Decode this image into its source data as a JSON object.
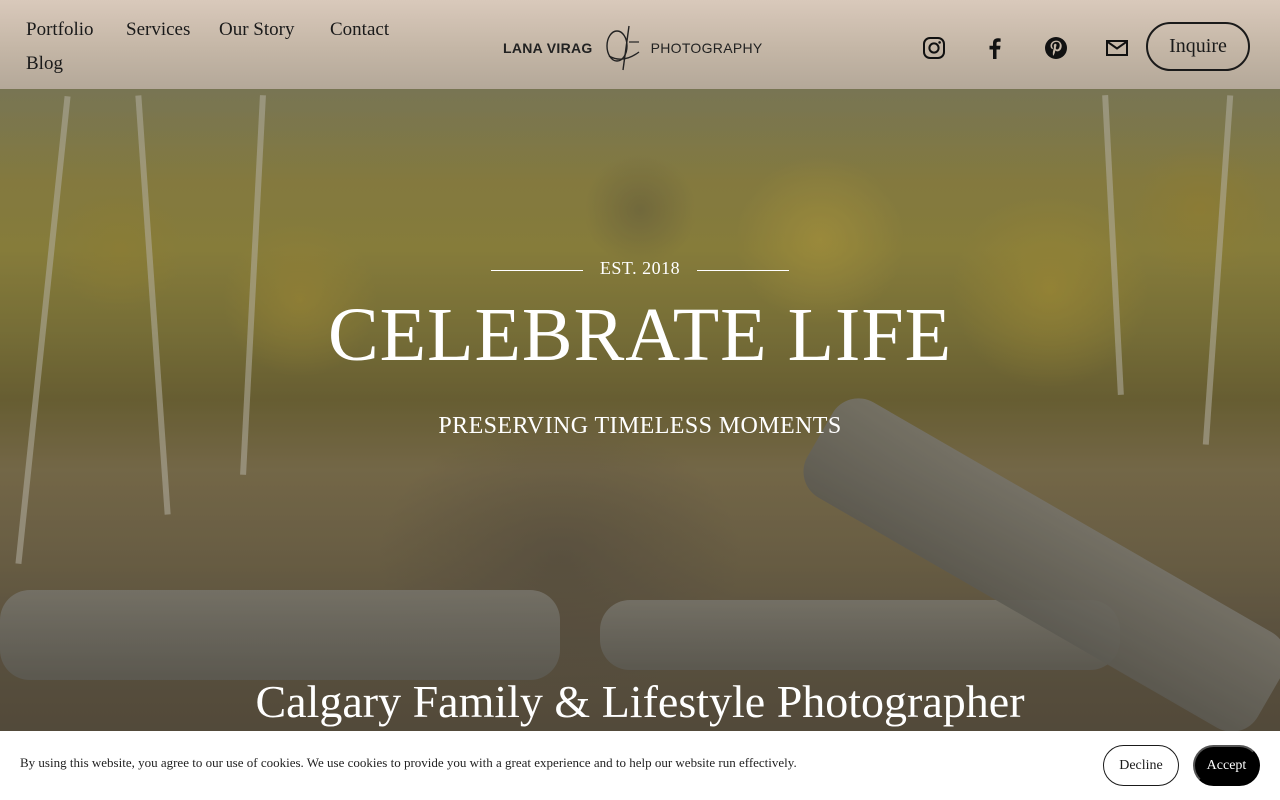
{
  "nav": {
    "items": [
      {
        "label": "Portfolio"
      },
      {
        "label": "Services"
      },
      {
        "label": "Our Story"
      },
      {
        "label": "Contact"
      },
      {
        "label": "Blog"
      }
    ]
  },
  "logo": {
    "left_text": "LANA VIRAG",
    "right_text": "PHOTOGRAPHY"
  },
  "social": [
    {
      "icon": "instagram-icon"
    },
    {
      "icon": "facebook-icon"
    },
    {
      "icon": "pinterest-icon"
    },
    {
      "icon": "email-icon"
    }
  ],
  "header": {
    "inquire_label": "Inquire"
  },
  "hero": {
    "est": "EST. 2018",
    "title": "CELEBRATE LIFE",
    "subtitle": "PRESERVING TIMELESS MOMENTS",
    "tagline": "Calgary Family & Lifestyle Photographer"
  },
  "cookie": {
    "text": "By using this website, you agree to our use of cookies. We use cookies to provide you with a great experience and to help our website run effectively.",
    "decline_label": "Decline",
    "accept_label": "Accept"
  },
  "colors": {
    "header_bg": "#c8b9aa",
    "text_dark": "#1a1a1a",
    "hero_text": "#ffffff",
    "accept_bg": "#000000"
  }
}
